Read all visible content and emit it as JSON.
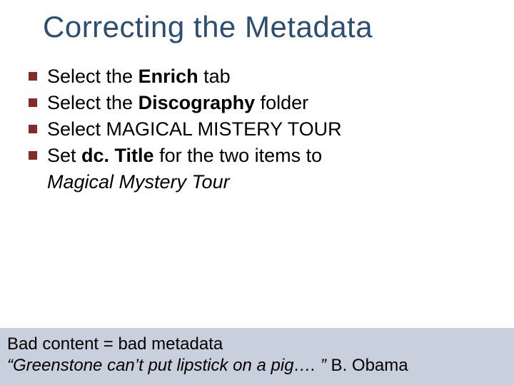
{
  "title": "Correcting the Metadata",
  "bullets": [
    {
      "pre": "Select the ",
      "bold": "Enrich",
      "post": " tab"
    },
    {
      "pre": "Select the ",
      "bold": "Discography",
      "post": " folder"
    },
    {
      "pre": "Select MAGICAL MISTERY TOUR",
      "bold": "",
      "post": ""
    },
    {
      "pre": "Set ",
      "bold": "dc. Title",
      "post": " for the two items to"
    }
  ],
  "continuation": "Magical Mystery Tour",
  "footer": {
    "line1": "Bad content = bad metadata",
    "line2_quote": "“Greenstone can’t put lipstick on a pig…. ”",
    "line2_attr": "  B. Obama"
  }
}
